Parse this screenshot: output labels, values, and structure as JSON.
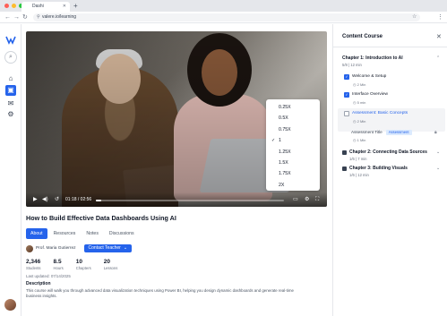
{
  "browser": {
    "tab_title": "Dashi",
    "url": "valere.io/learning",
    "colors": {
      "red": "#ff5f57",
      "yellow": "#febc2e",
      "green": "#28c840"
    }
  },
  "rail": {
    "logo_text": "VALERE",
    "icons": [
      "search-icon",
      "home-icon",
      "learning-icon",
      "chat-icon",
      "settings-icon"
    ]
  },
  "video": {
    "time": "01:18 / 02:56",
    "progress_fraction": 0.03,
    "speed_options": [
      "0.25X",
      "0.5X",
      "0.75X",
      "1",
      "1.25X",
      "1.5X",
      "1.75X",
      "2X"
    ],
    "selected_speed": "1"
  },
  "course": {
    "title": "How to Build Effective Data Dashboards Using AI",
    "tabs": [
      "About",
      "Resources",
      "Notes",
      "Discussions"
    ],
    "instructor": "Prof. Maria Gutierrez",
    "contact_label": "Contact Teacher",
    "stats": [
      {
        "value": "2,346",
        "label": "Students"
      },
      {
        "value": "8.5",
        "label": "Hours"
      },
      {
        "value": "10",
        "label": "Chapters"
      },
      {
        "value": "20",
        "label": "Lessons"
      }
    ],
    "updated": "Last updated: 07/14/2025",
    "description_title": "Description",
    "description": "This course will walk you through advanced data visualization techniques using Power BI, helping you design dynamic dashboards and generate real-time business insights."
  },
  "panel": {
    "title": "Content Course",
    "chapter1": {
      "title": "Chapter 1: Introduction to AI",
      "meta": "5/8 | 12 min"
    },
    "lessons": [
      {
        "title": "Welcome & Setup",
        "meta": "2 Min",
        "checked": true
      },
      {
        "title": "Interface Overview",
        "meta": "5 min",
        "checked": true
      },
      {
        "title": "Assessment: Basic Concepts",
        "meta": "2 Min",
        "checked": false
      }
    ],
    "sub_item": {
      "title": "Assessment Title",
      "badge": "Assessment",
      "meta": "1 Min"
    },
    "chapter2": {
      "title": "Chapter 2: Connecting Data Sources",
      "meta": "1/6 | 7 min"
    },
    "chapter3": {
      "title": "Chapter 3: Building Visuals",
      "meta": "1/6 | 12 min"
    }
  }
}
